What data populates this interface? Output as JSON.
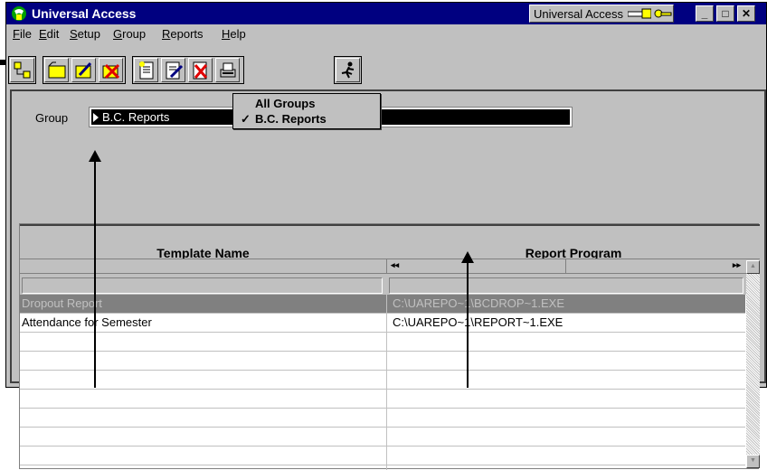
{
  "window": {
    "title": "Universal Access",
    "badge_text": "Universal Access",
    "caption_buttons": [
      "_",
      "□",
      "✕"
    ]
  },
  "menu": [
    {
      "key": "F",
      "rest": "ile"
    },
    {
      "key": "E",
      "rest": "dit"
    },
    {
      "key": "S",
      "rest": "etup"
    },
    {
      "key": "G",
      "rest": "roup"
    },
    {
      "key": "R",
      "rest": "eports"
    },
    {
      "key": "H",
      "rest": "elp"
    }
  ],
  "group": {
    "label": "Group",
    "selected": "B.C. Reports"
  },
  "dropdown": {
    "items": [
      "All Groups",
      "B.C. Reports"
    ],
    "checked_index": 1,
    "check_mark": "✓"
  },
  "grid": {
    "columns": [
      "Template Name",
      "Report Program"
    ],
    "rows": [
      {
        "name": "Dropout Report",
        "program": "C:\\UAREPO~1\\BCDROP~1.EXE",
        "selected": true
      },
      {
        "name": "Attendance for Semester",
        "program": "C:\\UAREPO~1\\REPORT~1.EXE",
        "selected": false
      }
    ],
    "scroll_left": "◂◂",
    "scroll_right": "▸▸"
  },
  "colors": {
    "titlebar": "#000080",
    "selected_row": "#808080",
    "selected_row_text": "#c0c0c0"
  }
}
